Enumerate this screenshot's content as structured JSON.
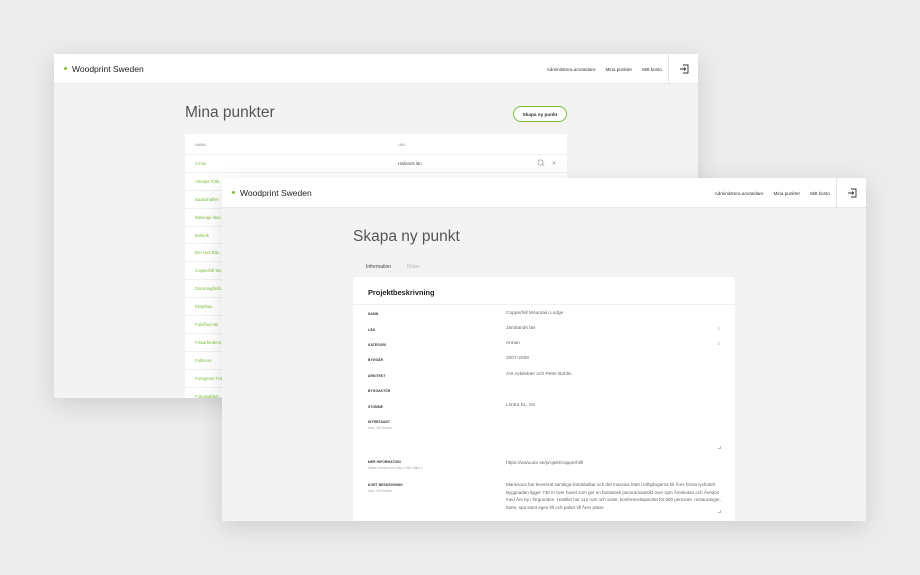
{
  "brand": "Woodprint Sweden",
  "nav": {
    "admin": "Administrera användare",
    "mina": "Mina punkter",
    "konto": "Mitt konto"
  },
  "colors": {
    "accent": "#7bbf3a"
  },
  "list_page": {
    "title": "Mina punkter",
    "new_button": "Skapa ny punkt",
    "columns": {
      "name": "NAMN",
      "lan": "LÄN"
    },
    "rows": [
      {
        "name": "A-hus",
        "lan": "Hallands län"
      },
      {
        "name": "Alnarps Träh…",
        "lan": ""
      },
      {
        "name": "Badanhallen",
        "lan": ""
      },
      {
        "name": "Blekinge läns…",
        "lan": ""
      },
      {
        "name": "Bokliok",
        "lan": ""
      },
      {
        "name": "Bro Hus Bäc…",
        "lan": ""
      },
      {
        "name": "Copperhill Mo…",
        "lan": ""
      },
      {
        "name": "Dammegårds…",
        "lan": ""
      },
      {
        "name": "Eksjöhus",
        "lan": ""
      },
      {
        "name": "Falufhus AB",
        "lan": ""
      },
      {
        "name": "Fiskarhedens…",
        "lan": ""
      },
      {
        "name": "Fullmore",
        "lan": ""
      },
      {
        "name": "Forsgrens Trä…",
        "lan": ""
      },
      {
        "name": "Fotoskafdett…",
        "lan": ""
      }
    ]
  },
  "form_page": {
    "title": "Skapa ny punkt",
    "tabs": [
      "Information",
      "Bilder"
    ],
    "section_title": "Projektbeskrivning",
    "fields": {
      "namn": {
        "label": "NAMN",
        "value": "Copperhill Mountain Lodge"
      },
      "lan": {
        "label": "LÄN",
        "value": "Jämtlands län"
      },
      "kategori": {
        "label": "KATEGORI",
        "value": "Annan"
      },
      "byggar": {
        "label": "BYGGÅR",
        "value": "2007-2008"
      },
      "arkitekt": {
        "label": "ARKITEKT",
        "value": "AIX Arkitekter och Peter Bohlin"
      },
      "byggaktor": {
        "label": "BYGGAKTÖR",
        "value": ""
      },
      "stomme": {
        "label": "STOMME",
        "value": "Limtra KL, trä"
      },
      "intressant": {
        "label": "INTRESSANT",
        "hint": "Max. 300 tecken",
        "value": ""
      },
      "mer_info": {
        "label": "MER INFORMATION",
        "hint": "Måste inledas med http:// eller https://",
        "value": "https://www.aix.se/projekt/copperhill/"
      },
      "kort": {
        "label": "KORT BESKRIVNING",
        "hint": "Max. 300 tecken",
        "value": "Marinsons har levererat samtliga limträbalkar och det massiva träet i toftgångarna till Åres första lyxhotell. Byggnaden ligger 730 m över havet som ger en fantastisk panoramautsikt över sjön Åreskutan och Åresjön med Åre by i förgrunden. Hotellet har 112 rum och sviter, konferenskapacitet för 600 personer, restauranger, barer, spa samt egen lift och pafart till Åres pister."
      }
    }
  }
}
